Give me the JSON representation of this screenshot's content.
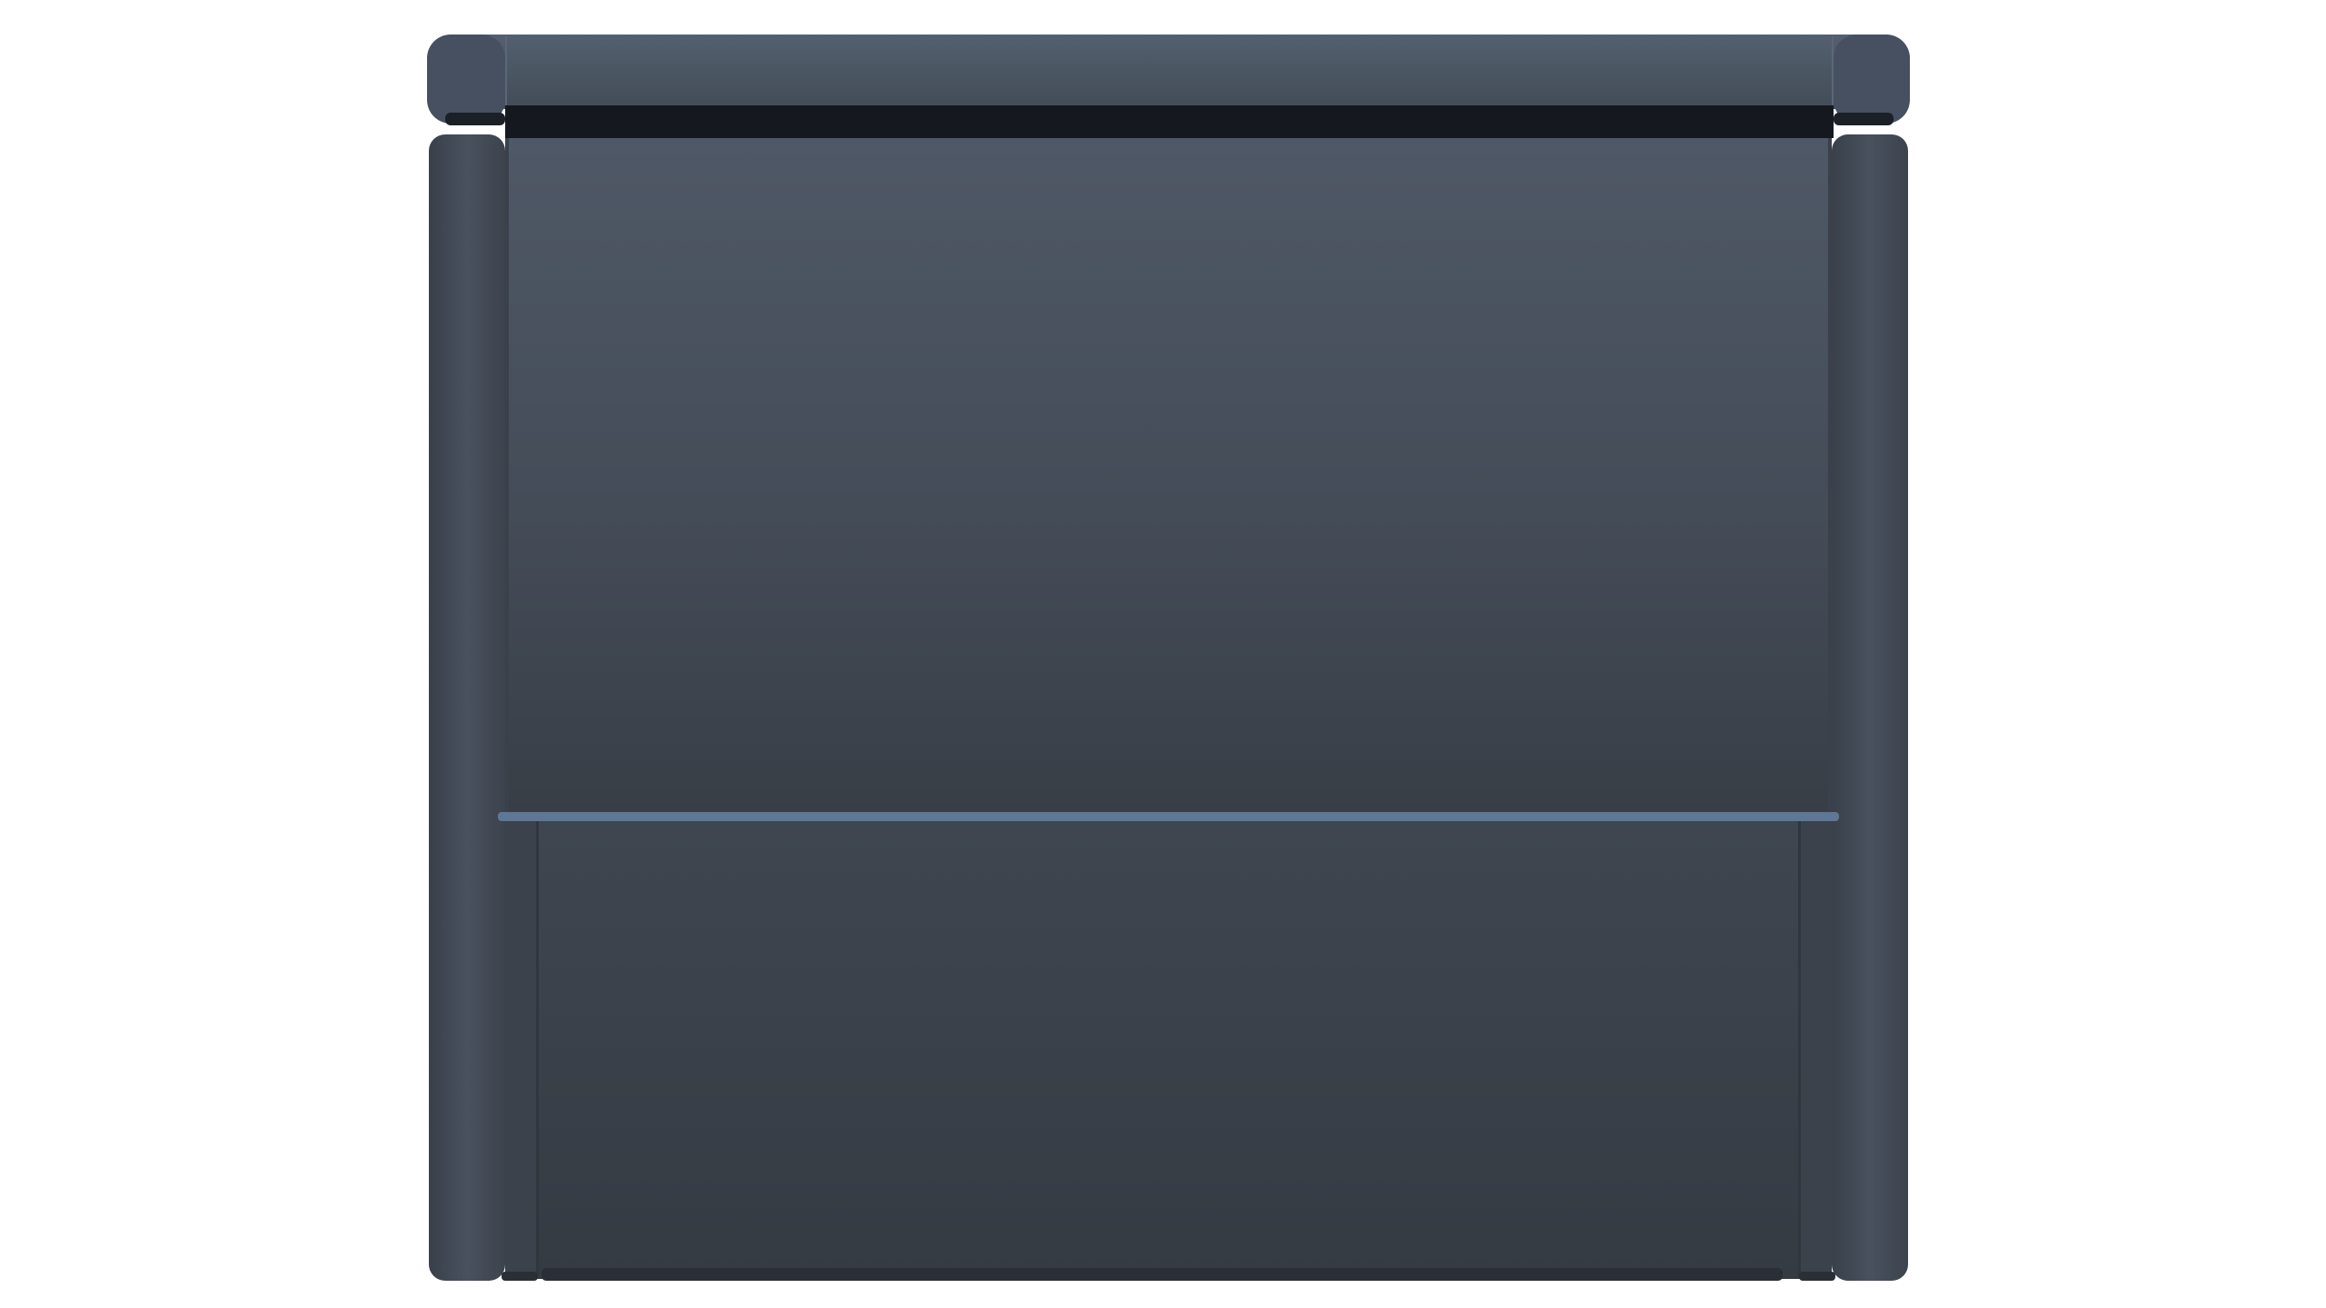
{
  "scene": {
    "subject": "storage-box-front-view",
    "background_color": "#ffffff",
    "body_color": "#444c57",
    "lid_color": "#4a5462",
    "trim_color": "#5d7896",
    "shadow_color": "#1c2128"
  }
}
